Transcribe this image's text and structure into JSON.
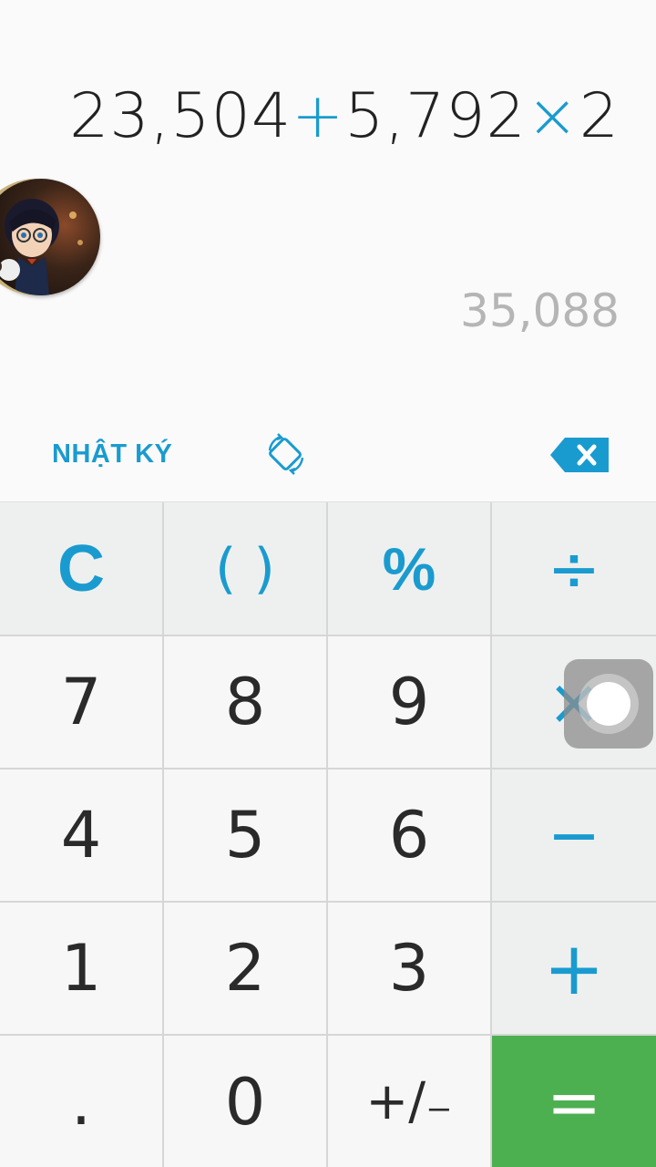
{
  "display": {
    "expr": {
      "n1": "23,504",
      "op1": "+",
      "n2": "5,792",
      "op2": "×",
      "n3": "2"
    },
    "result": "35,088"
  },
  "toolbar": {
    "history_label": "NHẬT KÝ",
    "rotate_icon": "rotate-screen-icon",
    "backspace_icon": "backspace-icon"
  },
  "keys": {
    "clear": "C",
    "parens": "( )",
    "percent": "%",
    "divide": "÷",
    "seven": "7",
    "eight": "8",
    "nine": "9",
    "multiply": "×",
    "four": "4",
    "five": "5",
    "six": "6",
    "minus": "−",
    "one": "1",
    "two": "2",
    "three": "3",
    "plus": "+",
    "dot": ".",
    "zero": "0",
    "sign": "+/₋",
    "equals": "="
  },
  "colors": {
    "accent": "#1a9bcf",
    "equals_bg": "#4caf50",
    "result_text": "#b5b5b5"
  }
}
